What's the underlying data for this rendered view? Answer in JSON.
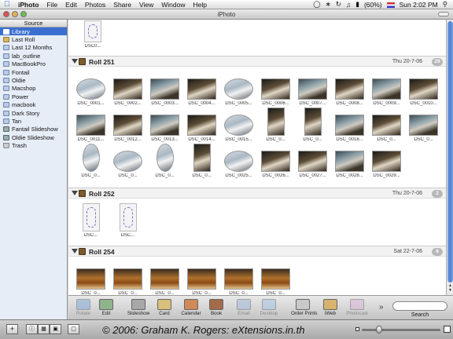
{
  "menubar": {
    "app_name": "iPhoto",
    "items": [
      "File",
      "Edit",
      "Photos",
      "Share",
      "View",
      "Window",
      "Help"
    ],
    "battery": "(60%)",
    "clock": "Sun 2:02 PM"
  },
  "window": {
    "title": "iPhoto"
  },
  "source": {
    "header": "Source",
    "items": [
      {
        "label": "Library",
        "icon": "library-icon"
      },
      {
        "label": "Last Roll",
        "icon": "roll-icon"
      },
      {
        "label": "Last 12 Months",
        "icon": "calendar-icon"
      },
      {
        "label": "lab_outline",
        "icon": "album-icon"
      },
      {
        "label": "MacBookPro",
        "icon": "album-icon"
      },
      {
        "label": "Fontail",
        "icon": "album-icon"
      },
      {
        "label": "Oldie",
        "icon": "album-icon"
      },
      {
        "label": "Macshop",
        "icon": "album-icon"
      },
      {
        "label": "Power",
        "icon": "album-icon"
      },
      {
        "label": "macbook",
        "icon": "album-icon"
      },
      {
        "label": "Dark Story",
        "icon": "album-icon"
      },
      {
        "label": "Tan",
        "icon": "album-icon"
      },
      {
        "label": "Fantail Slideshow",
        "icon": "slideshow-icon"
      },
      {
        "label": "Oldie Slideshow",
        "icon": "slideshow-icon"
      },
      {
        "label": "Trash",
        "icon": "trash-icon"
      }
    ]
  },
  "top_photo": {
    "caption": "DSC0..."
  },
  "rolls": [
    {
      "title": "Roll 251",
      "date": "Thu 20-7-06",
      "count": "29",
      "photos": [
        "DSC_0001...",
        "DSC_0002...",
        "DSC_0003...",
        "DSC_0004...",
        "DSC_0005...",
        "DSC_0006...",
        "DSC_0007...",
        "DSC_0008...",
        "DSC_0009...",
        "DSC_0010...",
        "DSC_0011...",
        "DSC_0012...",
        "DSC_0013...",
        "DSC_0014...",
        "DSC_0015...",
        "DSC_0...",
        "DSC_0...",
        "DSC_0018...",
        "DSC_0...",
        "DSC_0...",
        "DSC_0...",
        "DSC_0...",
        "DSC_0...",
        "DSC_0...",
        "DSC_0025...",
        "DSC_0026...",
        "DSC_0027...",
        "DSC_0028...",
        "DSC_0029..."
      ]
    },
    {
      "title": "Roll 252",
      "date": "Thu 20-7-06",
      "count": "2",
      "photos": [
        "DSC...",
        "DSC..."
      ]
    },
    {
      "title": "Roll 254",
      "date": "Sat 22-7-06",
      "count": "6",
      "photos": [
        "DSC_0...",
        "DSC_0...",
        "DSC_0...",
        "DSC_0...",
        "DSC_0...",
        "DSC_0..."
      ]
    }
  ],
  "toolbar": {
    "buttons": [
      {
        "label": "Rotate",
        "name": "rotate-button",
        "enabled": false
      },
      {
        "label": "Edit",
        "name": "edit-button",
        "enabled": true
      },
      {
        "label": "Slideshow",
        "name": "slideshow-button",
        "enabled": true
      },
      {
        "label": "Card",
        "name": "card-button",
        "enabled": true
      },
      {
        "label": "Calendar",
        "name": "calendar-button",
        "enabled": true
      },
      {
        "label": "Book",
        "name": "book-button",
        "enabled": true
      },
      {
        "label": "Email",
        "name": "email-button",
        "enabled": false
      },
      {
        "label": "Desktop",
        "name": "desktop-button",
        "enabled": false
      },
      {
        "label": "Order Prints",
        "name": "order-prints-button",
        "enabled": true
      },
      {
        "label": "iWeb",
        "name": "iweb-button",
        "enabled": true
      },
      {
        "label": "Photocast",
        "name": "photocast-button",
        "enabled": false
      }
    ],
    "search_label": "Search"
  },
  "bottombar": {
    "add_label": "+",
    "copyright": "© 2006: Graham K. Rogers: eXtensions.in.th"
  }
}
